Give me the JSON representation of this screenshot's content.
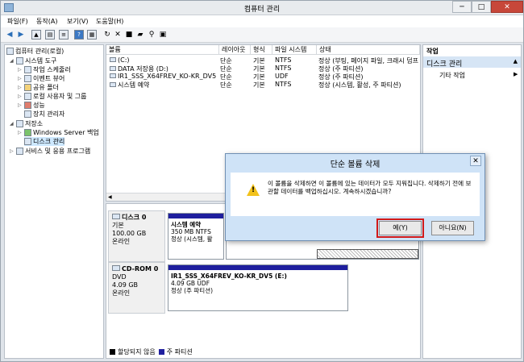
{
  "window": {
    "title": "컴퓨터 관리",
    "controls": [
      "─",
      "□",
      "✕"
    ]
  },
  "menu": [
    "파일(F)",
    "동작(A)",
    "보기(V)",
    "도움말(H)"
  ],
  "tree": {
    "root": "컴퓨터 관리(로컬)",
    "system_tools": "시스템 도구",
    "task_scheduler": "작업 스케줄러",
    "event_viewer": "이벤트 뷰어",
    "shared_folders": "공유 폴더",
    "local_users": "로컬 사용자 및 그룹",
    "performance": "성능",
    "device_manager": "장치 관리자",
    "storage": "저장소",
    "backup": "Windows Server 백업",
    "disk_mgmt": "디스크 관리",
    "services": "서비스 및 응용 프로그램"
  },
  "columns": [
    "볼륨",
    "레이아웃",
    "형식",
    "파일 시스템",
    "상태"
  ],
  "volumes": [
    {
      "name": "(C:)",
      "layout": "단순",
      "type": "기본",
      "fs": "NTFS",
      "status": "정상 (부팅, 페이지 파일, 크래시 덤프"
    },
    {
      "name": "DATA 저장용 (D:)",
      "layout": "단순",
      "type": "기본",
      "fs": "NTFS",
      "status": "정상 (주 파티션)"
    },
    {
      "name": "IR1_SSS_X64FREV_KO-KR_DV5 (E:)",
      "layout": "단순",
      "type": "기본",
      "fs": "UDF",
      "status": "정상 (주 파티션)"
    },
    {
      "name": "시스템 예약",
      "layout": "단순",
      "type": "기본",
      "fs": "NTFS",
      "status": "정상 (시스템, 활성, 주 파티션)"
    }
  ],
  "disk0": {
    "name": "디스크 0",
    "type": "기본",
    "size": "100.00 GB",
    "state": "온라인",
    "partition": {
      "name": "시스템 예약",
      "size": "350 MB NTFS",
      "status": "정상 (시스템, 활"
    }
  },
  "cdrom0": {
    "name": "CD-ROM 0",
    "type": "DVD",
    "size": "4.09 GB",
    "state": "온라인",
    "partition": {
      "name": "IR1_SSS_X64FREV_KO-KR_DV5 (E:)",
      "size": "4.09 GB UDF",
      "status": "정상 (주 파티션)"
    }
  },
  "legend": {
    "unallocated": "할당되지 않음",
    "primary": "주 파티션"
  },
  "actions": {
    "title": "작업",
    "section": "디스크 관리",
    "more": "기타 작업"
  },
  "dialog": {
    "title": "단순 볼륨 삭제",
    "message": "이 볼륨을 삭제하면 이 볼륨에 있는 데이터가 모두 지워집니다. 삭제하기 전에 보관할 데이터를 백업하십시오. 계속하시겠습니까?",
    "yes": "예(Y)",
    "no": "아니요(N)"
  },
  "colors": {
    "primary_partition": "#1f1f9e",
    "unallocated": "#000000",
    "highlight": "#d11a1a"
  }
}
